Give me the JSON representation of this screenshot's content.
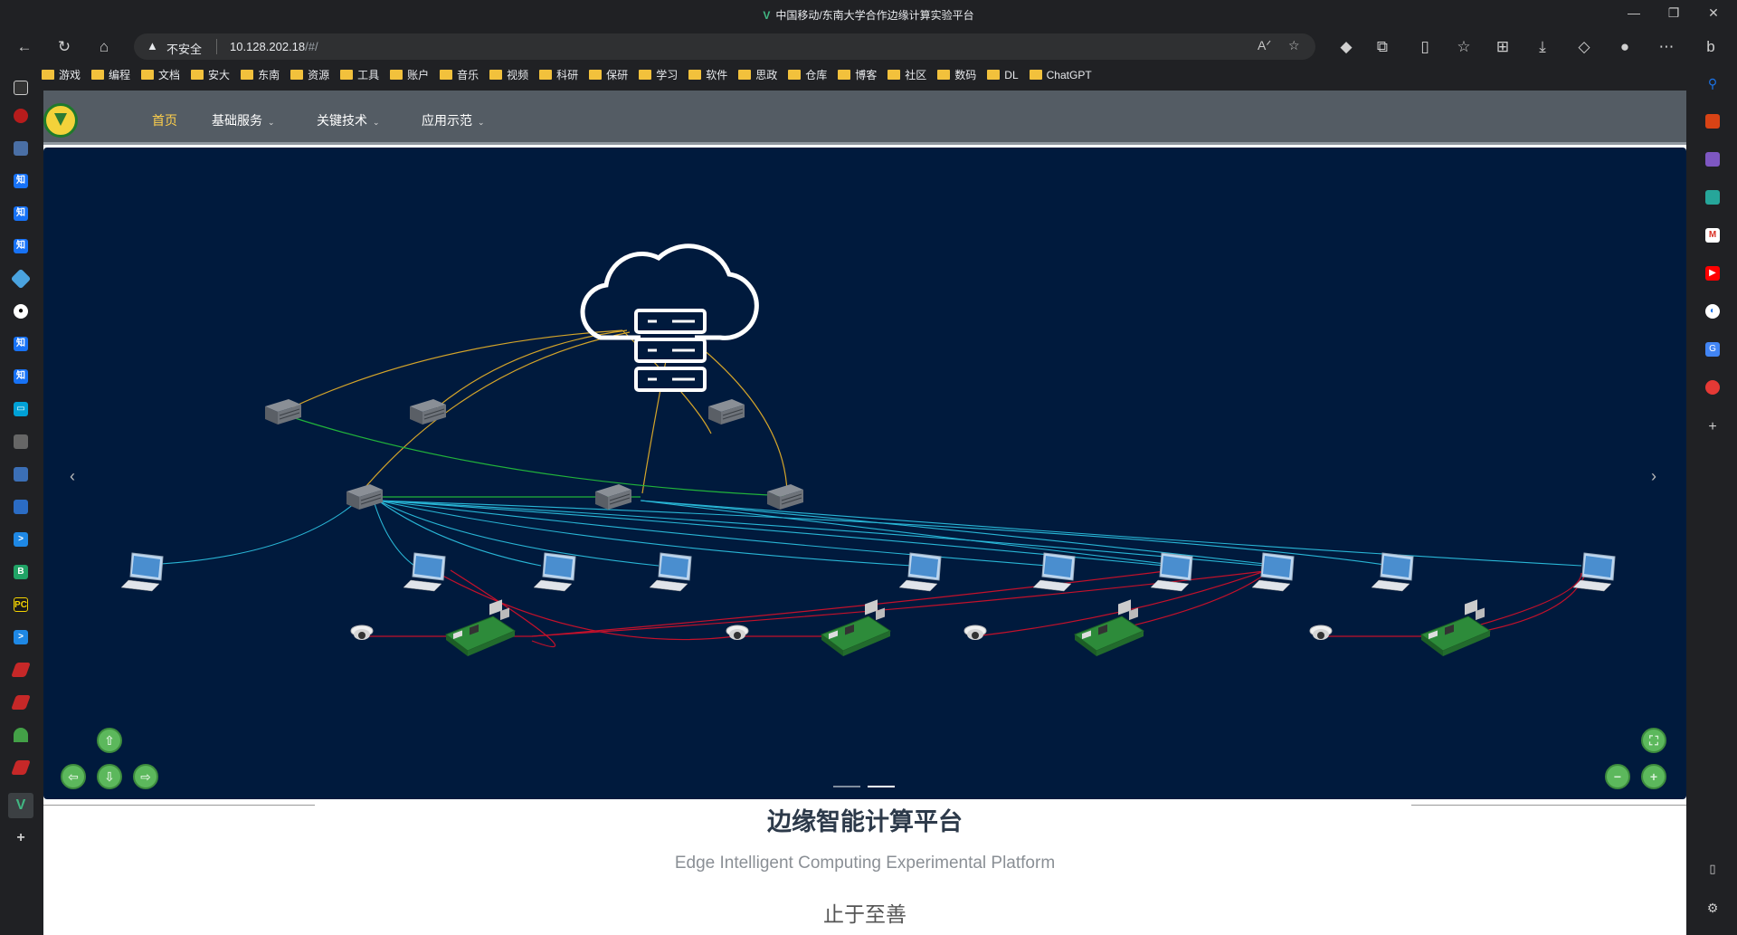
{
  "window": {
    "title": "中国移动/东南大学合作边缘计算实验平台"
  },
  "address_bar": {
    "security_label": "不安全",
    "url_host": "10.128.202.18",
    "url_path": "/#/"
  },
  "bookmarks": [
    "游戏",
    "编程",
    "文档",
    "安大",
    "东南",
    "资源",
    "工具",
    "账户",
    "音乐",
    "视频",
    "科研",
    "保研",
    "学习",
    "软件",
    "思政",
    "仓库",
    "博客",
    "社区",
    "数码",
    "DL",
    "ChatGPT"
  ],
  "nav": {
    "items": [
      {
        "label": "首页",
        "active": true
      },
      {
        "label": "基础服务",
        "dropdown": true
      },
      {
        "label": "关键技术",
        "dropdown": true
      },
      {
        "label": "应用示范",
        "dropdown": true
      }
    ]
  },
  "carousel": {
    "slide_count": 2,
    "active_slide": 2
  },
  "hero": {
    "title": "边缘智能计算平台",
    "subtitle": "Edge Intelligent Computing Experimental Platform",
    "motto": "止于至善"
  },
  "colors": {
    "nav_bg": "#545c64",
    "nav_active": "#ffd04b",
    "canvas_bg": "#001a3d",
    "link_yellow": "#d4a52a",
    "link_green": "#21b33b",
    "link_cyan": "#29b6d6",
    "link_red": "#c4112b",
    "control_green": "#5cb85c"
  },
  "icons": [
    "back-icon",
    "refresh-icon",
    "home-icon",
    "warning-icon",
    "favorites-icon",
    "extensions-icon",
    "downloads-icon",
    "more-icon",
    "cloud-server-icon",
    "switch-icon",
    "computer-icon",
    "camera-icon",
    "raspberry-pi-icon"
  ]
}
